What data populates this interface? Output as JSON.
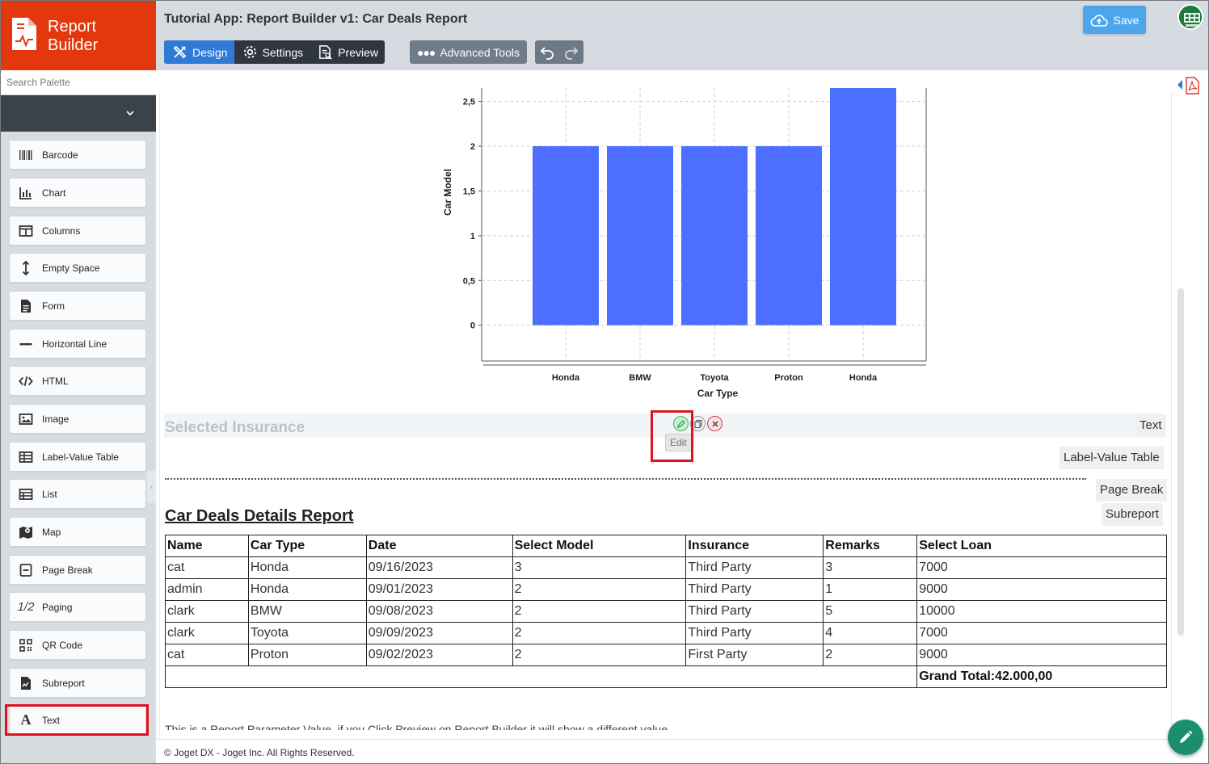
{
  "brand": {
    "line1": "Report",
    "line2": "Builder"
  },
  "header": {
    "title": "Tutorial App: Report Builder v1: Car Deals Report",
    "tabs": [
      {
        "label": "Design",
        "icon": "design-icon",
        "active": true
      },
      {
        "label": "Settings",
        "icon": "gear-icon",
        "active": false
      },
      {
        "label": "Preview",
        "icon": "preview-icon",
        "active": false
      }
    ],
    "advanced_tools": "Advanced Tools",
    "save_label": "Save"
  },
  "sidebar": {
    "search_placeholder": "Search Palette",
    "items": [
      {
        "label": "Barcode",
        "icon": "barcode-icon"
      },
      {
        "label": "Chart",
        "icon": "chart-icon"
      },
      {
        "label": "Columns",
        "icon": "columns-icon"
      },
      {
        "label": "Empty Space",
        "icon": "vertical-arrows-icon"
      },
      {
        "label": "Form",
        "icon": "form-icon"
      },
      {
        "label": "Horizontal Line",
        "icon": "horizontal-line-icon"
      },
      {
        "label": "HTML",
        "icon": "code-icon"
      },
      {
        "label": "Image",
        "icon": "image-icon"
      },
      {
        "label": "Label-Value Table",
        "icon": "table-icon"
      },
      {
        "label": "List",
        "icon": "list-icon"
      },
      {
        "label": "Map",
        "icon": "map-icon"
      },
      {
        "label": "Page Break",
        "icon": "page-break-icon"
      },
      {
        "label": "Paging",
        "icon": "paging-icon",
        "glyph": "1/2"
      },
      {
        "label": "QR Code",
        "icon": "qr-code-icon"
      },
      {
        "label": "Subreport",
        "icon": "subreport-icon"
      },
      {
        "label": "Text",
        "icon": "text-icon",
        "glyph": "A"
      }
    ]
  },
  "chart_data": {
    "type": "bar",
    "categories": [
      "Honda",
      "BMW",
      "Toyota",
      "Proton",
      "Honda"
    ],
    "values": [
      2,
      2,
      2,
      2,
      3
    ],
    "xlabel": "Car Type",
    "ylabel": "Car Model",
    "yticks": [
      "0",
      "0,5",
      "1",
      "1,5",
      "2",
      "2,5"
    ],
    "ylim": [
      -0.4,
      2.65
    ],
    "bar_color": "#4d6fff",
    "grid": true
  },
  "canvas": {
    "insurance_title": "Selected Insurance",
    "edit_tooltip": "Edit",
    "drop_labels": [
      "Text",
      "Label-Value Table",
      "Page Break",
      "Subreport"
    ],
    "report_title": "Car Deals Details Report",
    "table": {
      "headers": [
        "Name",
        "Car Type",
        "Date",
        "Select Model",
        "Insurance",
        "Remarks",
        "Select Loan"
      ],
      "rows": [
        [
          "cat",
          "Honda",
          "09/16/2023",
          "3",
          "Third Party",
          "3",
          "7000"
        ],
        [
          "admin",
          "Honda",
          "09/01/2023",
          "2",
          "Third Party",
          "1",
          "9000"
        ],
        [
          "clark",
          "BMW",
          "09/08/2023",
          "2",
          "Third Party",
          "5",
          "10000"
        ],
        [
          "clark",
          "Toyota",
          "09/09/2023",
          "2",
          "Third Party",
          "4",
          "7000"
        ],
        [
          "cat",
          "Proton",
          "09/02/2023",
          "2",
          "First Party",
          "2",
          "9000"
        ]
      ],
      "grand_total": "Grand Total:42.000,00"
    },
    "trailing_text": "This is a Report Parameter Value, if you Click Preview on Report Builder it will show a different value"
  },
  "footer": {
    "text": "© Joget DX - Joget Inc. All Rights Reserved."
  },
  "colors": {
    "brand": "#e3380e",
    "active_tab": "#2e7ad5",
    "save": "#4ba6ec",
    "highlight": "#e0121f",
    "fab": "#1a8f6f"
  }
}
